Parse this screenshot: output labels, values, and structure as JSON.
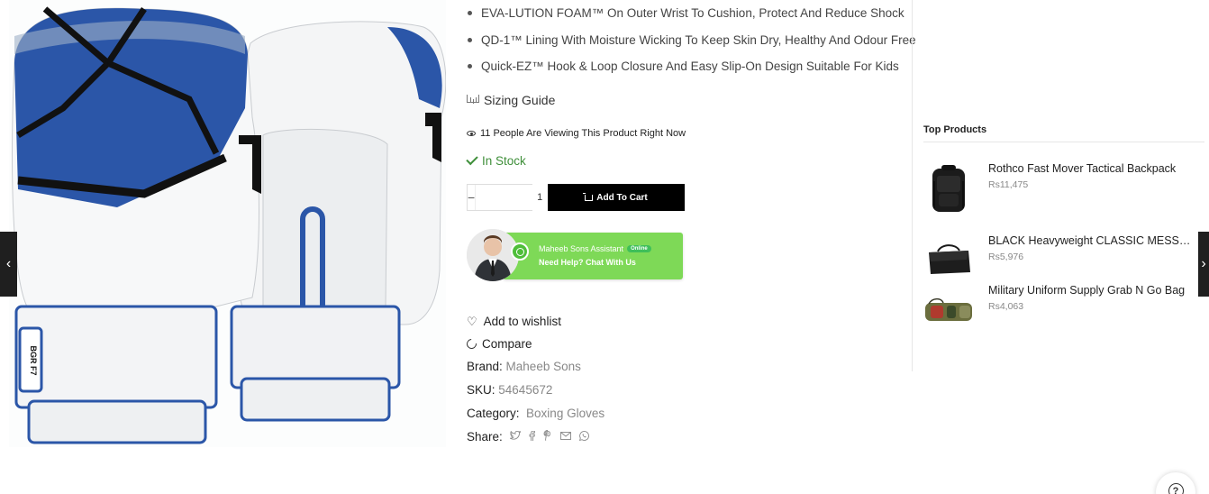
{
  "product": {
    "features": [
      "EVA-LUTION FOAM™ On Outer Wrist To Cushion, Protect And Reduce Shock",
      "QD-1™ Lining With Moisture Wicking To Keep Skin Dry, Healthy And Odour Free",
      "Quick-EZ™ Hook & Loop Closure And Easy Slip-On Design Suitable For Kids"
    ],
    "sizing_guide": "Sizing Guide",
    "viewing_text": "11 People Are Viewing This Product Right Now",
    "stock_status": "In Stock",
    "quantity": "1",
    "add_to_cart": "Add To Cart",
    "qty_minus": "−",
    "qty_plus": "+",
    "wishlist": "Add to wishlist",
    "compare": "Compare",
    "brand_label": "Brand:",
    "brand_value": "Maheeb Sons",
    "sku_label": "SKU:",
    "sku_value": "54645672",
    "category_label": "Category:",
    "category_value": "Boxing Gloves",
    "share_label": "Share:",
    "glove_mark": "BGR F7"
  },
  "whatsapp": {
    "name": "Maheeb Sons Assistant",
    "status": "Online",
    "help": "Need Help? Chat With Us"
  },
  "sidebar": {
    "title": "Top Products",
    "items": [
      {
        "name": "Rothco Fast Mover Tactical Backpack",
        "price": "Rs11,475"
      },
      {
        "name": "BLACK Heavyweight CLASSIC MESSENGER BAG",
        "price": "Rs5,976"
      },
      {
        "name": "Military Uniform Supply Grab N Go Bag",
        "price": "Rs4,063"
      }
    ]
  },
  "icons": {
    "prev": "chevron-left-icon",
    "next": "chevron-right-icon",
    "help": "help-icon"
  },
  "colors": {
    "glove_blue": "#2b56a8",
    "cart_button": "#000000",
    "stock_green": "#3f8f3a",
    "whatsapp_green": "#7ed957"
  },
  "help_glyph": "?"
}
